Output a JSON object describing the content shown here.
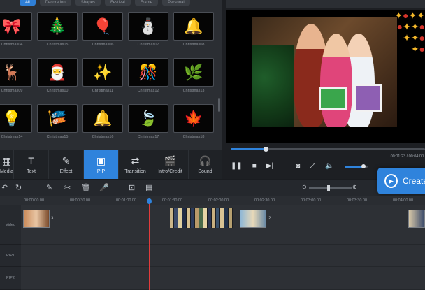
{
  "app": {
    "accent": "#2f83dc",
    "playhead_color": "#e23b3b"
  },
  "library": {
    "category_tabs": [
      {
        "label": "All",
        "active": true
      },
      {
        "label": "Decoration",
        "active": false
      },
      {
        "label": "Shapes",
        "active": false
      },
      {
        "label": "Festival",
        "active": false
      },
      {
        "label": "Frame",
        "active": false
      },
      {
        "label": "Personal",
        "active": false
      }
    ],
    "items": [
      {
        "label": "Christmas04",
        "icon": "ribbon-bow-icon",
        "glyph": "🎀"
      },
      {
        "label": "Christmas05",
        "icon": "christmas-tree-icon",
        "glyph": "🎄"
      },
      {
        "label": "Christmas06",
        "icon": "balloons-icon",
        "glyph": "🎈"
      },
      {
        "label": "Christmas07",
        "icon": "snowman-icon",
        "glyph": "⛄"
      },
      {
        "label": "Christmas08",
        "icon": "bells-icon",
        "glyph": "🔔"
      },
      {
        "label": "Christmas09",
        "icon": "reindeer-icon",
        "glyph": "🦌"
      },
      {
        "label": "Christmas10",
        "icon": "santa-icon",
        "glyph": "🎅"
      },
      {
        "label": "Christmas11",
        "icon": "garland-icon",
        "glyph": "✨"
      },
      {
        "label": "Christmas12",
        "icon": "ornament-branch-icon",
        "glyph": "🎊"
      },
      {
        "label": "Christmas13",
        "icon": "holly-garland-icon",
        "glyph": "🌿"
      },
      {
        "label": "Christmas14",
        "icon": "light-string-icon",
        "glyph": "💡"
      },
      {
        "label": "Christmas15",
        "icon": "bunting-icon",
        "glyph": "🎏"
      },
      {
        "label": "Christmas16",
        "icon": "gold-bells-icon",
        "glyph": "🔔"
      },
      {
        "label": "Christmas17",
        "icon": "green-leaf-icon",
        "glyph": "🍃"
      },
      {
        "label": "Christmas18",
        "icon": "maple-leaf-icon",
        "glyph": "🍁"
      }
    ]
  },
  "toolbar": {
    "tools": [
      {
        "label": "Media",
        "icon": "media-icon",
        "glyph": "▦",
        "active": false
      },
      {
        "label": "Text",
        "icon": "text-icon",
        "glyph": "T",
        "active": false
      },
      {
        "label": "Effect",
        "icon": "magic-wand-icon",
        "glyph": "✎",
        "active": false
      },
      {
        "label": "PIP",
        "icon": "pip-icon",
        "glyph": "▣",
        "active": true
      },
      {
        "label": "Transition",
        "icon": "transition-icon",
        "glyph": "⇄",
        "active": false
      },
      {
        "label": "Intro/Credit",
        "icon": "clapper-icon",
        "glyph": "🎬",
        "active": false
      },
      {
        "label": "Sound",
        "icon": "headphones-icon",
        "glyph": "🎧",
        "active": false
      }
    ]
  },
  "preview": {
    "seek_progress": 0.18,
    "volume_level": 0.8,
    "time_readout": "00:01:23 / 00:04:00"
  },
  "create_button": {
    "label": "Create"
  },
  "timeline": {
    "ruler_ticks": [
      "00:00:00.00",
      "00:00:30.00",
      "00:01:00.00",
      "00:01:30.00",
      "00:02:00.00",
      "00:02:30.00",
      "00:03:00.00",
      "00:03:30.00",
      "00:04:00.00"
    ],
    "tracks": [
      {
        "label": "Video"
      },
      {
        "label": "PIP1"
      },
      {
        "label": "PIP2"
      }
    ],
    "clips": [
      {
        "number": "3"
      },
      {
        "number": "2"
      }
    ]
  }
}
